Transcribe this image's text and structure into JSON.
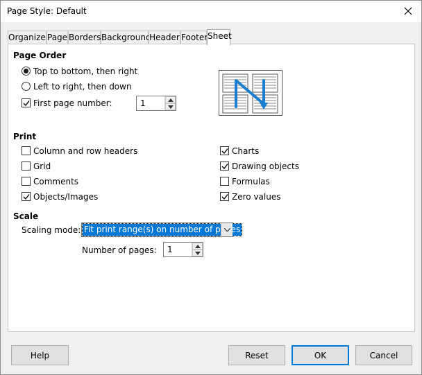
{
  "window": {
    "title": "Page Style: Default"
  },
  "tabs": [
    "Organizer",
    "Page",
    "Borders",
    "Background",
    "Header",
    "Footer",
    "Sheet"
  ],
  "active_tab": "Sheet",
  "page_order": {
    "heading": "Page Order",
    "top_to_bottom": {
      "label": "Top to bottom, then right",
      "selected": true
    },
    "left_to_right": {
      "label": "Left to right, then down",
      "selected": false
    },
    "first_page_number": {
      "label": "First page number:",
      "checked": true,
      "value": "1"
    }
  },
  "print": {
    "heading": "Print",
    "column_row_headers": {
      "label": "Column and row headers",
      "checked": false
    },
    "grid": {
      "label": "Grid",
      "checked": false
    },
    "comments": {
      "label": "Comments",
      "checked": false
    },
    "objects_images": {
      "label": "Objects/Images",
      "checked": true
    },
    "charts": {
      "label": "Charts",
      "checked": true
    },
    "drawing_objects": {
      "label": "Drawing objects",
      "checked": true
    },
    "formulas": {
      "label": "Formulas",
      "checked": false
    },
    "zero_values": {
      "label": "Zero values",
      "checked": true
    }
  },
  "scale": {
    "heading": "Scale",
    "scaling_mode_label": "Scaling mode:",
    "scaling_mode_value": "Fit print range(s) on number of pages",
    "number_of_pages_label": "Number of pages:",
    "number_of_pages_value": "1"
  },
  "buttons": {
    "help": "Help",
    "reset": "Reset",
    "ok": "OK",
    "cancel": "Cancel"
  },
  "colors": {
    "accent": "#0078d7",
    "preview_arrow": "#1a7fd0"
  },
  "icons": {
    "close": "close-icon",
    "spin_up": "spin-up-icon",
    "spin_down": "spin-down-icon",
    "dropdown": "chevron-down-icon",
    "check": "checkmark-icon"
  }
}
